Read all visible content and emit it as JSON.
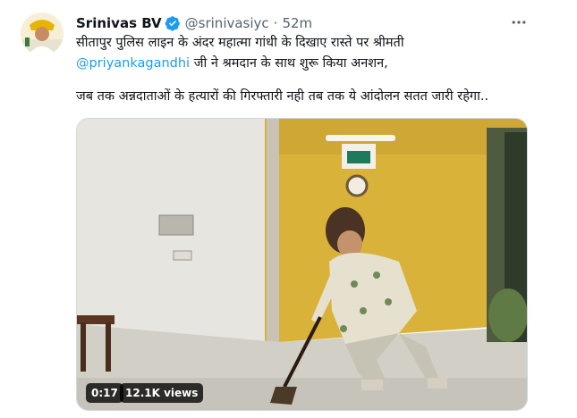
{
  "tweet": {
    "author_name": "Srinivas BV",
    "handle": "@srinivasiyc",
    "separator": "·",
    "time": "52m",
    "line1": "सीतापुर पुलिस लाइन के अंदर महात्मा गांधी के दिखाए रास्ते पर श्रीमती",
    "mention": "@priyankagandhi",
    "line2_rest": " जी ने श्रमदान के साथ शुरू किया अनशन,",
    "line3": "जब तक अन्नदाताओं के हत्यारों की गिरफ्तारी नही तब तक ये आंदोलन सतत जारी रहेगा..",
    "video_time": "0:17",
    "video_views": "12.1K views"
  },
  "colors": {
    "accent": "#1d9bf0",
    "secondary_text": "#536471",
    "wall_yellow": "#d9b23a"
  },
  "icons": {
    "verified": "verified-badge-icon",
    "more": "more-horizontal-icon"
  }
}
